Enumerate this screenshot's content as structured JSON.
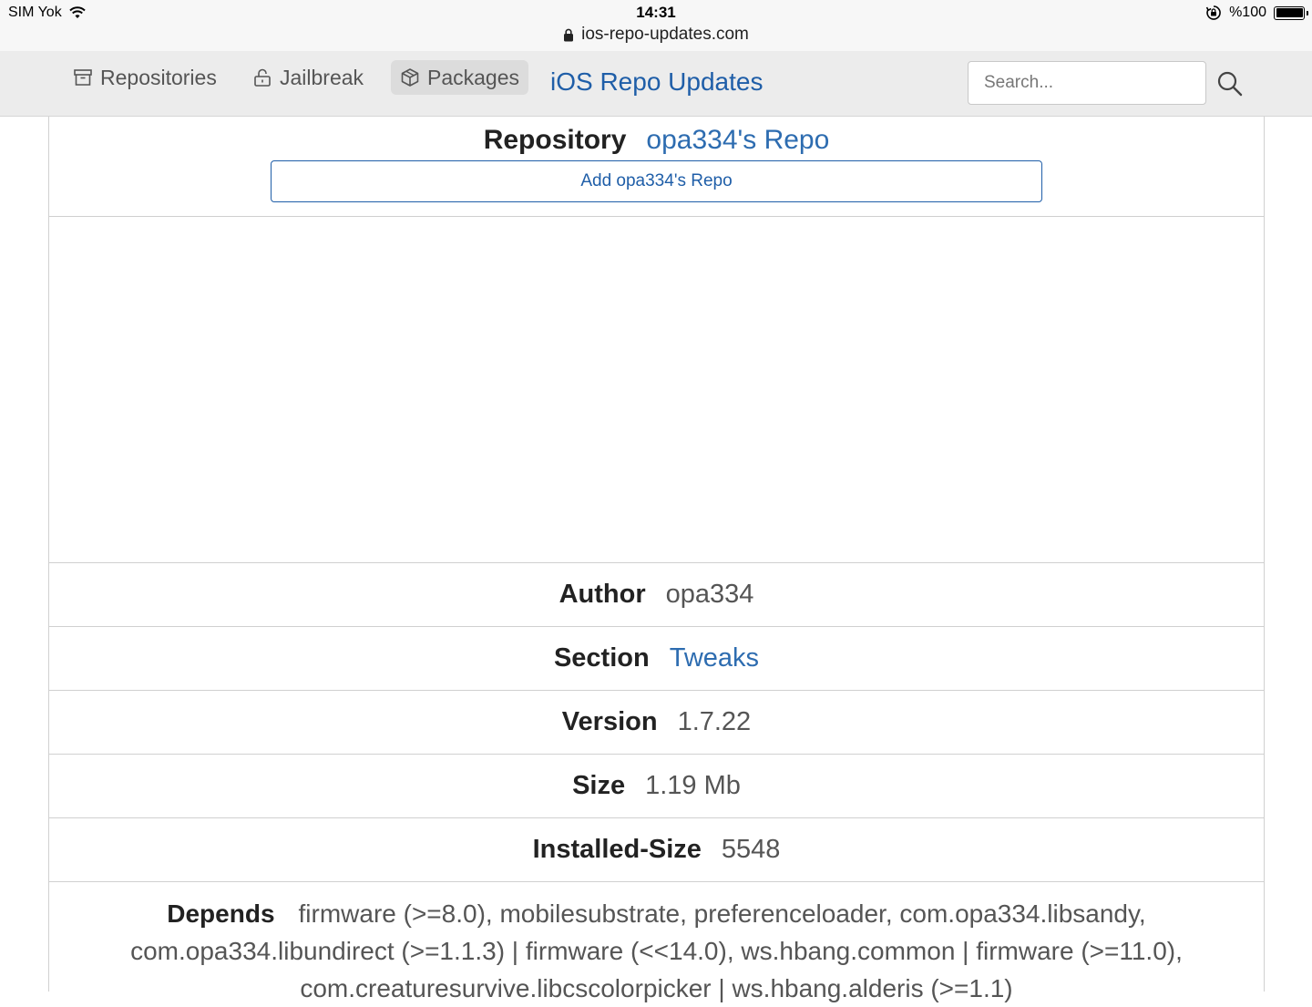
{
  "status_bar": {
    "carrier": "SIM Yok",
    "time": "14:31",
    "url": "ios-repo-updates.com",
    "battery": "%100"
  },
  "nav": {
    "items": [
      {
        "label": "Repositories",
        "icon": "archive-icon"
      },
      {
        "label": "Jailbreak",
        "icon": "unlock-icon"
      },
      {
        "label": "Packages",
        "icon": "package-icon",
        "active": true
      }
    ],
    "brand": "iOS Repo Updates",
    "search_placeholder": "Search..."
  },
  "repository": {
    "label": "Repository",
    "name": "opa334's Repo",
    "add_button": "Add opa334's Repo"
  },
  "details": [
    {
      "label": "Author",
      "value": "opa334"
    },
    {
      "label": "Section",
      "value": "Tweaks",
      "link": true
    },
    {
      "label": "Version",
      "value": "1.7.22"
    },
    {
      "label": "Size",
      "value": "1.19 Mb"
    },
    {
      "label": "Installed-Size",
      "value": "5548"
    }
  ],
  "depends": {
    "label": "Depends",
    "value": "firmware (>=8.0), mobilesubstrate, preferenceloader, com.opa334.libsandy, com.opa334.libundirect (>=1.1.3) | firmware (<<14.0), ws.hbang.common | firmware (>=11.0), com.creaturesurvive.libcscolorpicker | ws.hbang.alderis (>=1.1)"
  },
  "colors": {
    "accent": "#1f5ea8",
    "link": "#2d6cb0",
    "navbar_bg": "#ececec",
    "border": "#d0d0d0"
  }
}
